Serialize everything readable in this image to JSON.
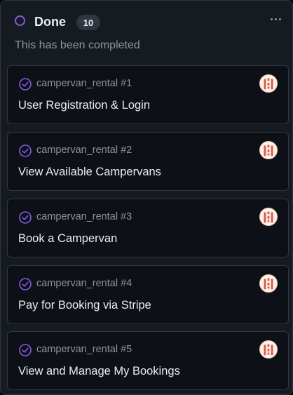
{
  "column": {
    "title": "Done",
    "count": "10",
    "description": "This has been completed",
    "more_icon": "kebab-horizontal-icon",
    "status_color": "#8957e5"
  },
  "cards": [
    {
      "ref": "campervan_rental #1",
      "title": "User Registration & Login",
      "status_icon": "issue-closed-icon",
      "avatar": "identicon-avatar"
    },
    {
      "ref": "campervan_rental #2",
      "title": "View Available Campervans",
      "status_icon": "issue-closed-icon",
      "avatar": "identicon-avatar"
    },
    {
      "ref": "campervan_rental #3",
      "title": "Book a Campervan",
      "status_icon": "issue-closed-icon",
      "avatar": "identicon-avatar"
    },
    {
      "ref": "campervan_rental #4",
      "title": "Pay for Booking via Stripe",
      "status_icon": "issue-closed-icon",
      "avatar": "identicon-avatar"
    },
    {
      "ref": "campervan_rental #5",
      "title": "View and Manage My Bookings",
      "status_icon": "issue-closed-icon",
      "avatar": "identicon-avatar"
    }
  ],
  "colors": {
    "background": "#161b22",
    "card_background": "#0d1117",
    "border": "#30363d",
    "completed_purple": "#8957e5",
    "muted_text": "#8b949e",
    "avatar_red": "#d95a45"
  }
}
